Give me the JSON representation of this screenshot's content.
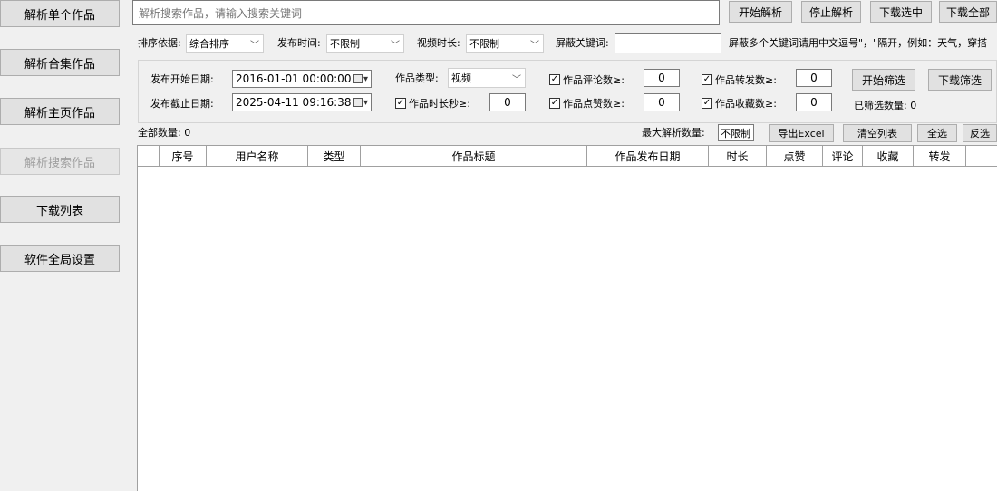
{
  "sidebar": {
    "items": [
      {
        "label": "解析单个作品"
      },
      {
        "label": "解析合集作品"
      },
      {
        "label": "解析主页作品"
      },
      {
        "label": "解析搜索作品"
      },
      {
        "label": "下载列表"
      },
      {
        "label": "软件全局设置"
      }
    ]
  },
  "search": {
    "placeholder": "解析搜索作品，请输入搜索关键词",
    "value": ""
  },
  "toolbar": {
    "start_label": "开始解析",
    "stop_label": "停止解析",
    "download_selected_label": "下载选中",
    "download_all_label": "下载全部"
  },
  "options": {
    "sort_label": "排序依据:",
    "sort_value": "综合排序",
    "publish_time_label": "发布时间:",
    "publish_time_value": "不限制",
    "duration_label": "视频时长:",
    "duration_value": "不限制",
    "block_keyword_label": "屏蔽关键词:",
    "block_keyword_value": "",
    "block_hint": "屏蔽多个关键词请用中文逗号\"，\"隔开，例如：天气，穿搭"
  },
  "filter": {
    "start_date_label": "发布开始日期:",
    "start_date_value": "2016-01-01 00:00:00",
    "end_date_label": "发布截止日期:",
    "end_date_value": "2025-04-11 09:16:38",
    "type_label": "作品类型:",
    "type_value": "视频",
    "duration_label": "作品时长秒≥:",
    "duration_value": "0",
    "comments_label": "作品评论数≥:",
    "comments_value": "0",
    "likes_label": "作品点赞数≥:",
    "likes_value": "0",
    "shares_label": "作品转发数≥:",
    "shares_value": "0",
    "favorites_label": "作品收藏数≥:",
    "favorites_value": "0",
    "start_filter_label": "开始筛选",
    "download_filter_label": "下载筛选",
    "filtered_count_label": "已筛选数量: 0",
    "check_mark": "✓"
  },
  "list_bar": {
    "total_label": "全部数量: 0",
    "max_label": "最大解析数量:",
    "max_value": "不限制",
    "export_label": "导出Excel",
    "clear_label": "清空列表",
    "select_all_label": "全选",
    "invert_label": "反选"
  },
  "table": {
    "columns": [
      "",
      "序号",
      "用户名称",
      "类型",
      "作品标题",
      "作品发布日期",
      "时长",
      "点赞",
      "评论",
      "收藏",
      "转发",
      ""
    ]
  }
}
